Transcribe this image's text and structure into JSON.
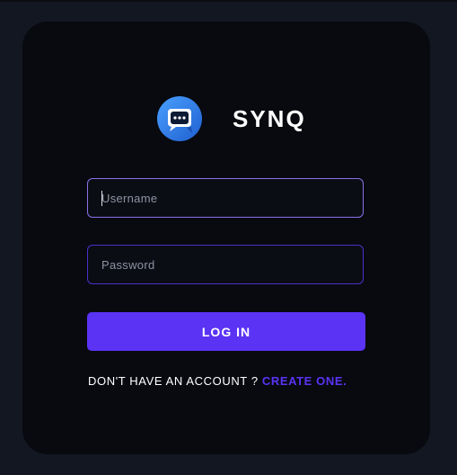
{
  "brand": {
    "name": "SYNQ",
    "logo_icon": "chat-bubble-icon",
    "logo_color": "#2f7fe6"
  },
  "form": {
    "username": {
      "placeholder": "Username",
      "value": ""
    },
    "password": {
      "placeholder": "Password",
      "value": ""
    },
    "login_label": "LOG IN"
  },
  "signup": {
    "prompt": "DON'T HAVE AN ACCOUNT ?",
    "link_label": "CREATE ONE."
  },
  "colors": {
    "page_background": "#131722",
    "card_background": "#080a10",
    "accent": "#5b33f5",
    "focused_border": "#8a6fe8"
  }
}
